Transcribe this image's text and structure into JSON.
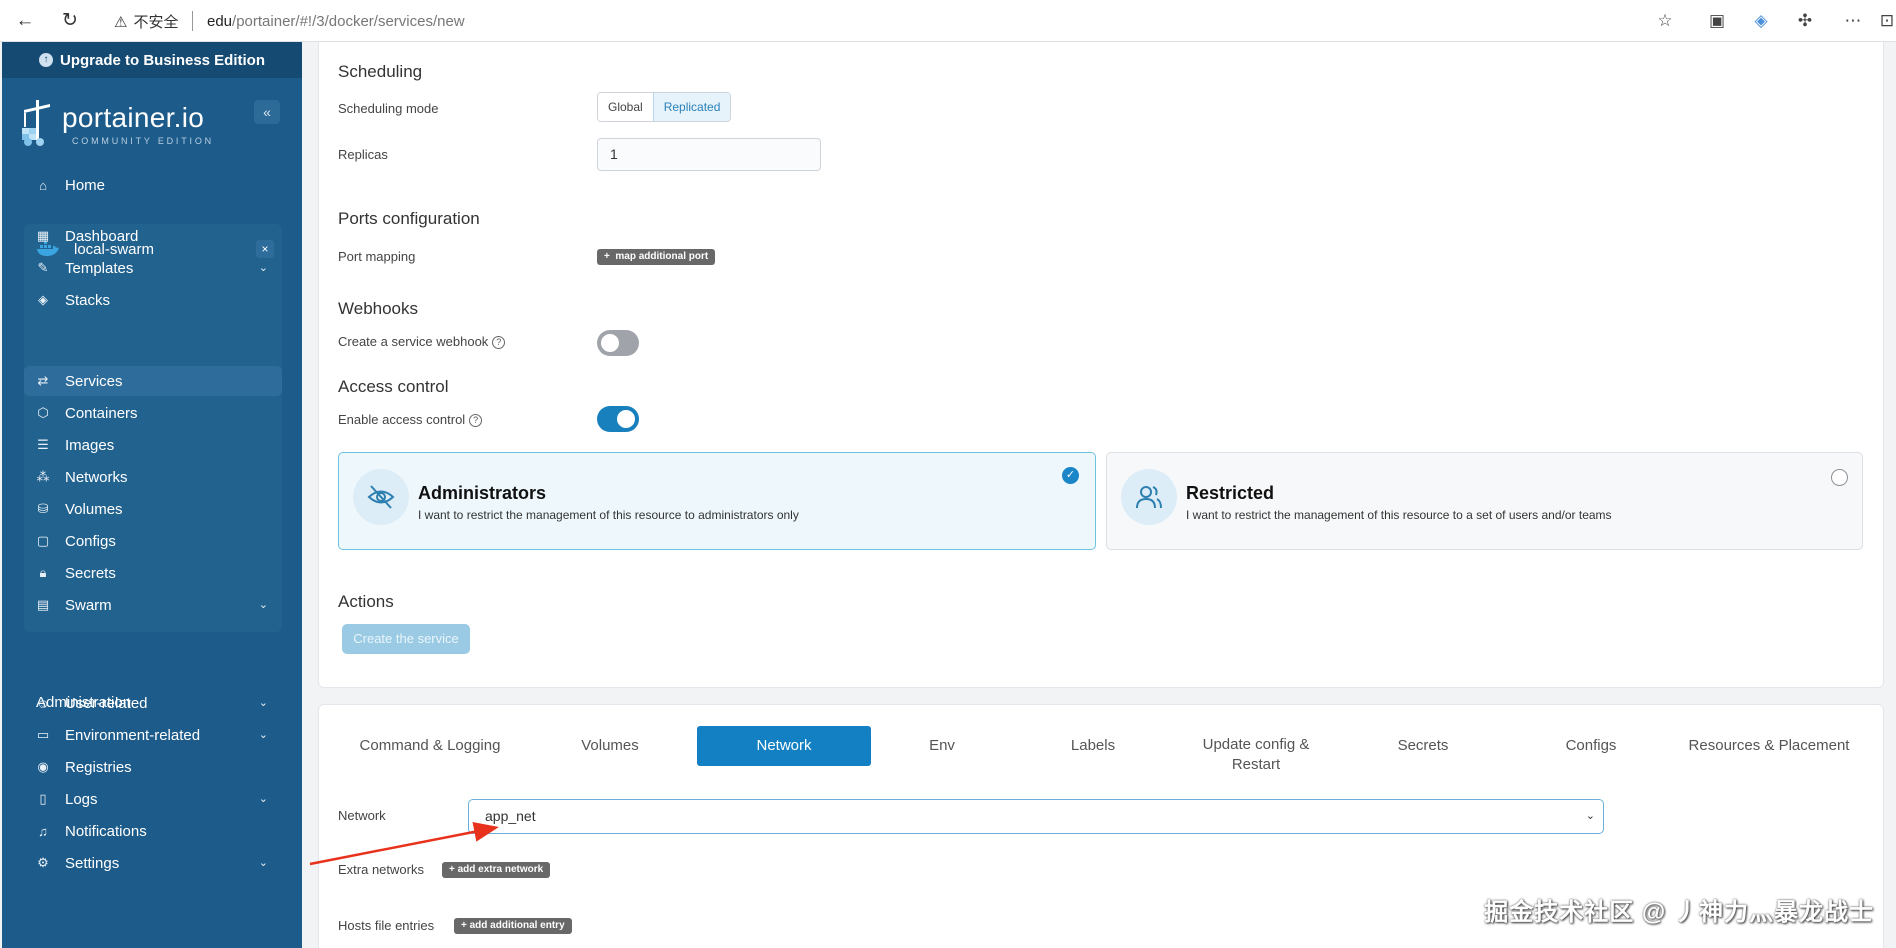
{
  "browser": {
    "security_label": "不安全",
    "url_host": "edu",
    "url_path": "/portainer/#!/3/docker/services/new"
  },
  "sidebar": {
    "upgrade_label": "Upgrade to Business Edition",
    "logo_text": "portainer.io",
    "logo_sub": "COMMUNITY EDITION",
    "home_label": "Home",
    "environment": {
      "name": "local-swarm",
      "items": [
        {
          "label": "Dashboard",
          "icon": "dashboard-icon"
        },
        {
          "label": "Templates",
          "icon": "templates-icon",
          "expandable": true
        },
        {
          "label": "Stacks",
          "icon": "stacks-icon"
        },
        {
          "label": "Services",
          "icon": "services-icon",
          "active": true
        },
        {
          "label": "Containers",
          "icon": "containers-icon"
        },
        {
          "label": "Images",
          "icon": "images-icon"
        },
        {
          "label": "Networks",
          "icon": "networks-icon"
        },
        {
          "label": "Volumes",
          "icon": "volumes-icon"
        },
        {
          "label": "Configs",
          "icon": "configs-icon"
        },
        {
          "label": "Secrets",
          "icon": "secrets-icon"
        },
        {
          "label": "Swarm",
          "icon": "swarm-icon",
          "expandable": true
        }
      ]
    },
    "administration_heading": "Administration",
    "admin_items": [
      {
        "label": "User-related",
        "icon": "users-icon",
        "expandable": true
      },
      {
        "label": "Environment-related",
        "icon": "environment-icon",
        "expandable": true
      },
      {
        "label": "Registries",
        "icon": "registries-icon"
      },
      {
        "label": "Logs",
        "icon": "logs-icon",
        "expandable": true
      },
      {
        "label": "Notifications",
        "icon": "bell-icon"
      },
      {
        "label": "Settings",
        "icon": "gear-icon",
        "expandable": true
      }
    ]
  },
  "form": {
    "scheduling": {
      "title": "Scheduling",
      "mode_label": "Scheduling mode",
      "mode_options": [
        "Global",
        "Replicated"
      ],
      "mode_selected": "Replicated",
      "replicas_label": "Replicas",
      "replicas_value": "1"
    },
    "ports": {
      "title": "Ports configuration",
      "mapping_label": "Port mapping",
      "add_button": "map additional port"
    },
    "webhooks": {
      "title": "Webhooks",
      "create_label": "Create a service webhook",
      "enabled": false
    },
    "access": {
      "title": "Access control",
      "enable_label": "Enable access control",
      "enabled": true,
      "admin_title": "Administrators",
      "admin_desc": "I want to restrict the management of this resource to administrators only",
      "restricted_title": "Restricted",
      "restricted_desc": "I want to restrict the management of this resource to a set of users and/or teams",
      "selected": "Administrators"
    },
    "actions": {
      "title": "Actions",
      "create_button": "Create the service"
    }
  },
  "tabs": {
    "items": [
      "Command & Logging",
      "Volumes",
      "Network",
      "Env",
      "Labels",
      "Update config & Restart",
      "Secrets",
      "Configs",
      "Resources & Placement"
    ],
    "active": "Network",
    "update_line1": "Update config &",
    "update_line2": "Restart"
  },
  "network": {
    "network_label": "Network",
    "network_value": "app_net",
    "extra_label": "Extra networks",
    "extra_button": "add extra network",
    "hosts_label": "Hosts file entries",
    "hosts_button": "add additional entry"
  },
  "watermark": "掘金技术社区 @ 丿神力灬暴龙战士",
  "colors": {
    "sidebar": "#1d5b8a",
    "accent": "#1380c3"
  }
}
